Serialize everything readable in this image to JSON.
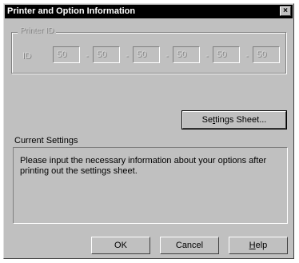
{
  "window": {
    "title": "Printer and Option Information",
    "close_symbol": "×"
  },
  "printer_id": {
    "group_label": "Printer ID",
    "field_label": "ID",
    "separator": "-",
    "fields": [
      "50",
      "50",
      "50",
      "50",
      "50",
      "50"
    ]
  },
  "settings_sheet_button": {
    "label_prefix": "Se",
    "label_accel": "t",
    "label_suffix": "tings Sheet..."
  },
  "current_settings": {
    "label": "Current Settings",
    "text": "Please input the necessary information about your options after printing out the settings sheet."
  },
  "footer": {
    "ok_label": "OK",
    "cancel_label": "Cancel",
    "help_accel": "H",
    "help_suffix": "elp"
  }
}
